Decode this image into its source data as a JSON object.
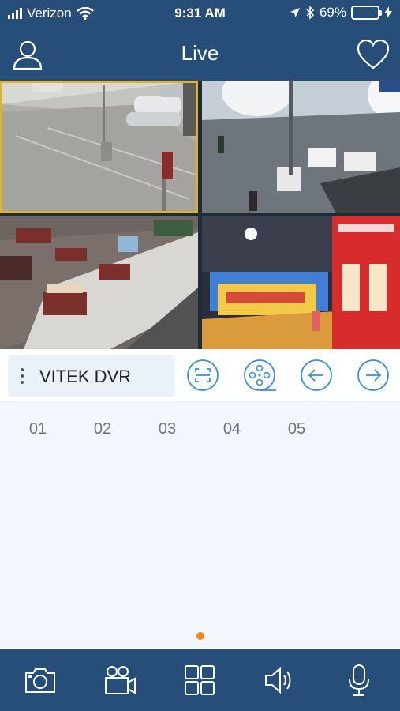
{
  "status_bar": {
    "carrier": "Verizon",
    "time": "9:31 AM",
    "battery_percent": "69%",
    "battery_level": 0.69,
    "icons": [
      "signal-icon",
      "wifi-icon",
      "location-icon",
      "bluetooth-icon",
      "battery-icon",
      "charging-icon"
    ]
  },
  "nav": {
    "title": "Live",
    "left_icon": "user-icon",
    "right_icon": "heart-icon"
  },
  "cameras": [
    {
      "name": "camera-1",
      "selected": true
    },
    {
      "name": "camera-2",
      "selected": false
    },
    {
      "name": "camera-3",
      "selected": false
    },
    {
      "name": "camera-4",
      "selected": false
    }
  ],
  "controls": {
    "device_name": "VITEK DVR",
    "buttons": [
      "scan-icon",
      "film-reel-icon",
      "arrow-left-icon",
      "arrow-right-icon"
    ]
  },
  "channels": [
    "01",
    "02",
    "03",
    "04",
    "05"
  ],
  "pager": {
    "active_page": 1,
    "page_count": 1
  },
  "toolbar": {
    "buttons": [
      "camera-icon",
      "video-camera-icon",
      "grid-layout-icon",
      "speaker-icon",
      "microphone-icon"
    ]
  },
  "colors": {
    "header": "#264e78",
    "selected_outline": "#d9b23a",
    "page_dot": "#f5871f",
    "battery_fill": "#4cd964"
  }
}
